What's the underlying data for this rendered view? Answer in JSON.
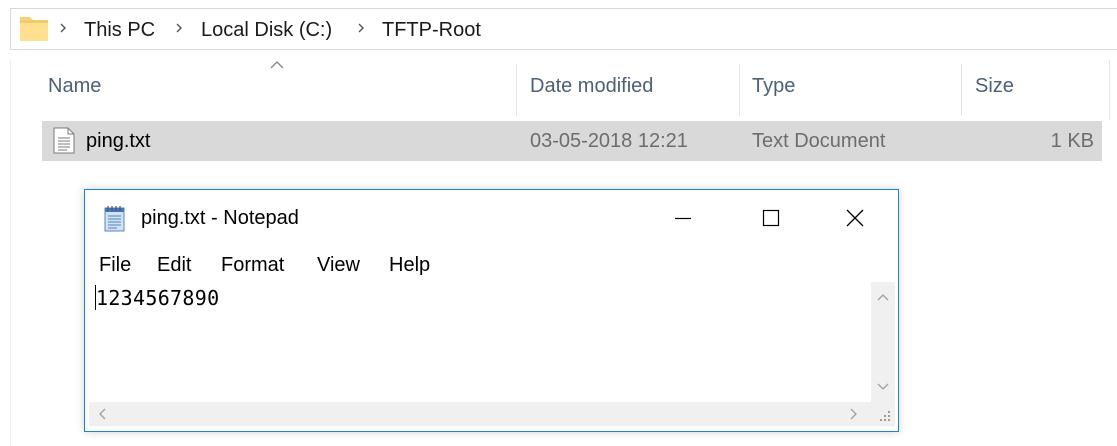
{
  "explorer": {
    "breadcrumb": [
      "This PC",
      "Local Disk (C:)",
      "TFTP-Root"
    ],
    "columns": {
      "name": "Name",
      "date_modified": "Date modified",
      "type": "Type",
      "size": "Size"
    },
    "files": [
      {
        "name": "ping.txt",
        "date_modified": "03-05-2018 12:21",
        "type": "Text Document",
        "size": "1 KB"
      }
    ]
  },
  "notepad": {
    "title": "ping.txt - Notepad",
    "menu": [
      "File",
      "Edit",
      "Format",
      "View",
      "Help"
    ],
    "content": "1234567890",
    "accent_color": "#1883d7"
  },
  "icons": {
    "folder": "folder-icon",
    "text_file": "text-file-icon",
    "notepad": "notepad-icon"
  }
}
